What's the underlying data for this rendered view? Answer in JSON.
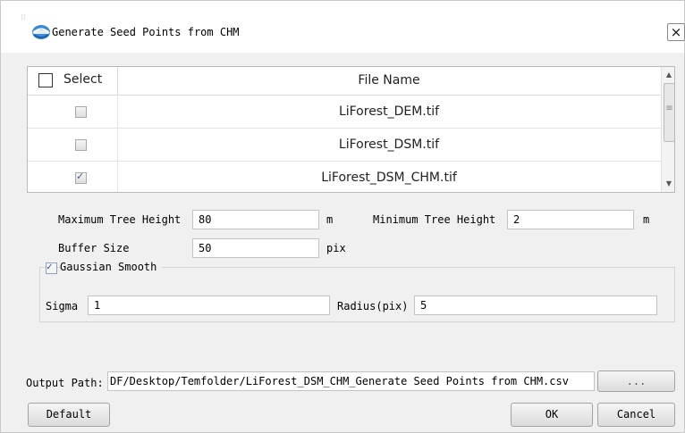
{
  "window": {
    "title": "Generate Seed Points from CHM",
    "close_label": "×"
  },
  "table": {
    "headers": {
      "select": "Select",
      "file_name": "File Name"
    },
    "rows": [
      {
        "checked": false,
        "name": "LiForest_DEM.tif"
      },
      {
        "checked": false,
        "name": "LiForest_DSM.tif"
      },
      {
        "checked": true,
        "name": "LiForest_DSM_CHM.tif"
      }
    ]
  },
  "params": {
    "max_height_label": "Maximum Tree Height",
    "max_height_value": "80",
    "max_height_unit": "m",
    "min_height_label": "Minimum Tree Height",
    "min_height_value": "2",
    "min_height_unit": "m",
    "buffer_label": "Buffer Size",
    "buffer_value": "50",
    "buffer_unit": "pix"
  },
  "gaussian": {
    "label": "Gaussian Smooth",
    "checked": true,
    "sigma_label": "Sigma",
    "sigma_value": "1",
    "radius_label": "Radius(pix)",
    "radius_value": "5"
  },
  "output": {
    "label": "Output Path:",
    "value": "DF/Desktop/Temfolder/LiForest_DSM_CHM_Generate Seed Points from CHM.csv",
    "browse_label": "..."
  },
  "buttons": {
    "default": "Default",
    "ok": "OK",
    "cancel": "Cancel"
  }
}
